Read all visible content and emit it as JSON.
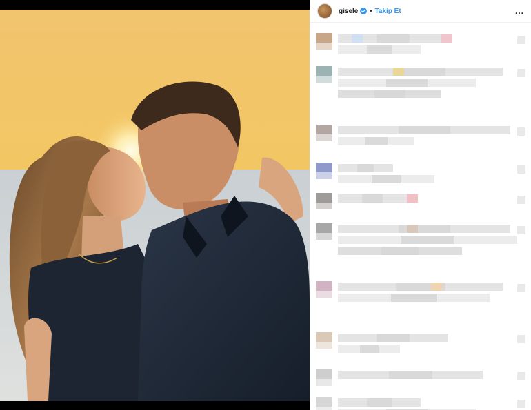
{
  "post": {
    "username": "gisele",
    "verified": true,
    "separator": "•",
    "follow_label": "Takip Et",
    "more_icon": "..."
  },
  "colors": {
    "follow_blue": "#3897f0",
    "verified_blue": "#3897f0",
    "sky_gold": "#f2c164",
    "dark_shirt": "#1f2a3a"
  },
  "comments_blurred": true,
  "comment_count_visible": 10
}
